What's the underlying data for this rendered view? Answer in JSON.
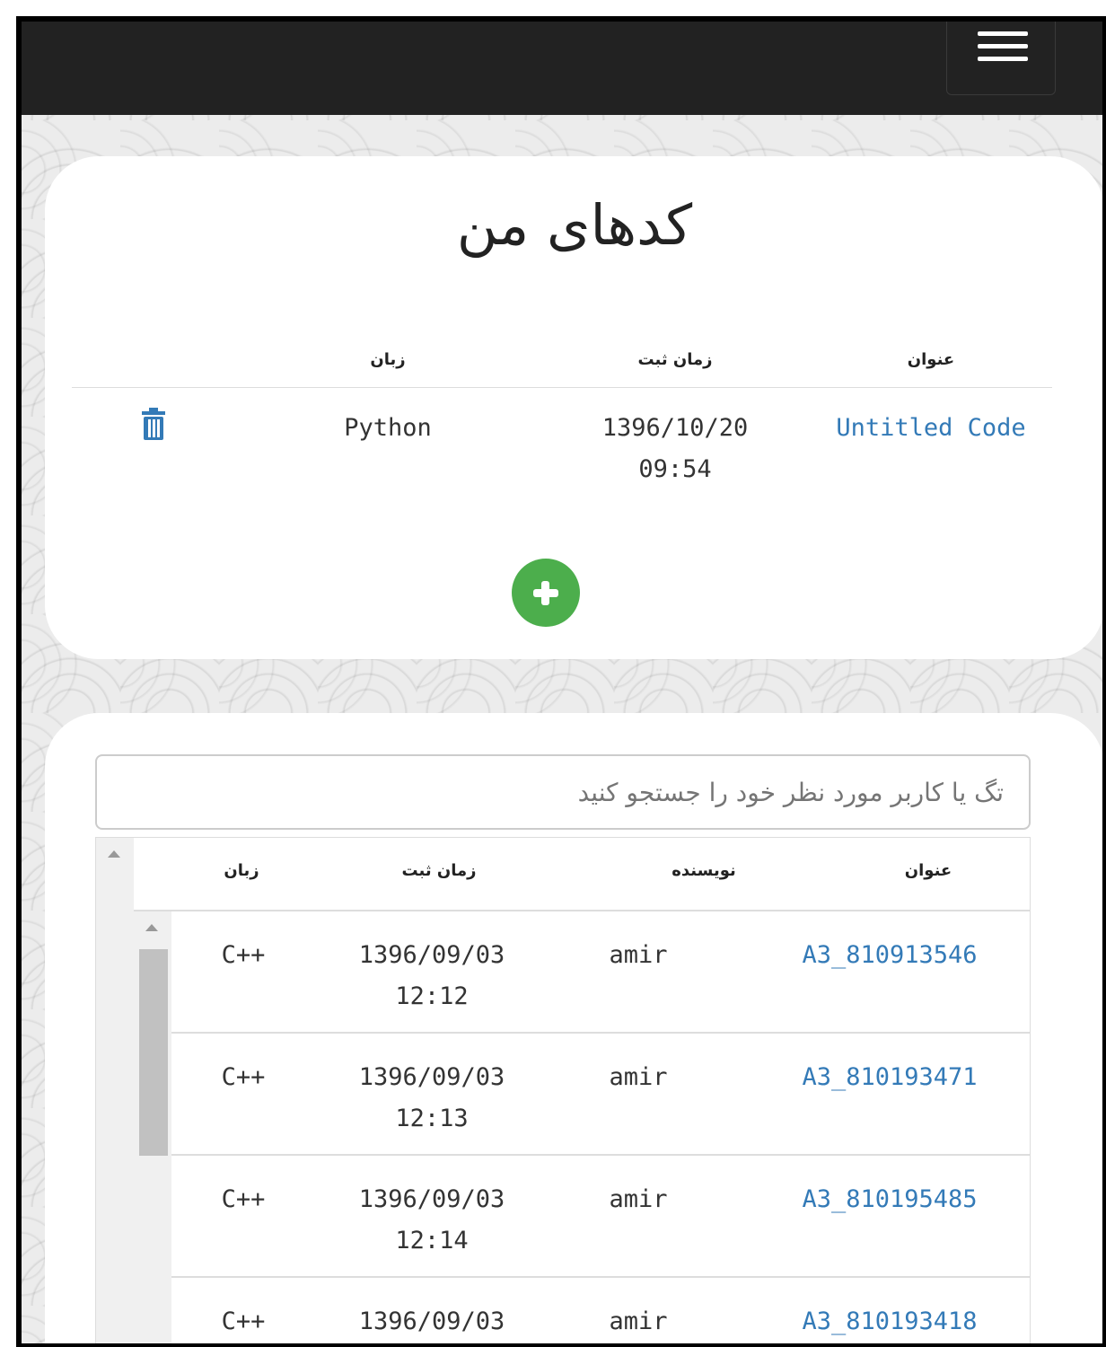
{
  "my_codes": {
    "title": "کدهای من",
    "columns": {
      "title": "عنوان",
      "created": "زمان ثبت",
      "language": "زبان"
    },
    "rows": [
      {
        "title": "Untitled Code",
        "date": "1396/10/20",
        "time": "09:54",
        "language": "Python",
        "action_icon": "trash-icon"
      }
    ],
    "add_icon": "plus-icon",
    "add_color": "#4cae4c"
  },
  "search": {
    "placeholder": "تگ یا کاربر مورد نظر خود را جستجو کنید"
  },
  "public_codes": {
    "columns": {
      "title": "عنوان",
      "author": "نویسنده",
      "created": "زمان ثبت",
      "language": "زبان"
    },
    "rows": [
      {
        "title": "A3_810913546",
        "author": "amir",
        "date": "1396/09/03",
        "time": "12:12",
        "language": "C++"
      },
      {
        "title": "A3_810193471",
        "author": "amir",
        "date": "1396/09/03",
        "time": "12:13",
        "language": "C++"
      },
      {
        "title": "A3_810195485",
        "author": "amir",
        "date": "1396/09/03",
        "time": "12:14",
        "language": "C++"
      },
      {
        "title": "A3_810193418",
        "author": "amir",
        "date": "1396/09/03",
        "time": "",
        "language": "C++"
      }
    ]
  },
  "colors": {
    "navbar": "#222222",
    "link": "#337ab7"
  }
}
